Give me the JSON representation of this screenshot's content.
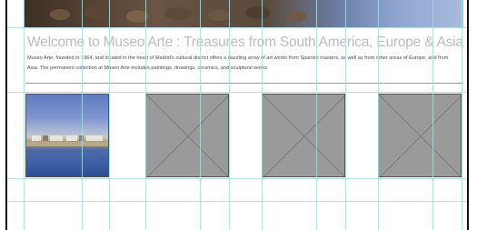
{
  "page": {
    "title": "Welcome to Museo Arte : Treasures from South America, Europe & Asia",
    "intro": "Museo Arte, founded in 1964, and located in the heart of Madrid's cultural district offers a dazzling array of art works from Spanish masters, as well as from other areas of Europe, and from Asia. The permanent collection at Museo Arte includes paintings, drawings, ceramics, and sculptural works."
  },
  "banner": {
    "image": "rocky-shore-photo"
  },
  "gallery": {
    "items": [
      {
        "kind": "photo",
        "image": "seaside-town-reflection-photo"
      },
      {
        "kind": "placeholder",
        "image": "image-placeholder-icon"
      },
      {
        "kind": "placeholder",
        "image": "image-placeholder-icon"
      },
      {
        "kind": "placeholder",
        "image": "image-placeholder-icon"
      }
    ]
  },
  "colors": {
    "guide": "#a9dbe1",
    "title": "#b9bcc0",
    "placeholder": "#9a9a9a"
  }
}
